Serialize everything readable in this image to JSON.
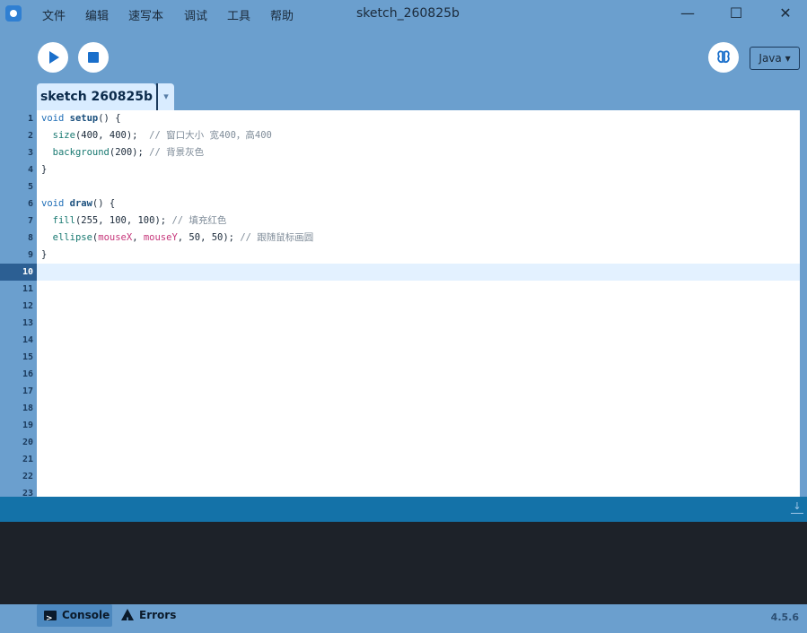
{
  "app": {
    "window_title": "sketch_260825b",
    "version": "4.5.6"
  },
  "menu": {
    "items": [
      "文件",
      "编辑",
      "速写本",
      "调试",
      "工具",
      "帮助"
    ]
  },
  "window_controls": {
    "minimize": "—",
    "maximize": "☐",
    "close": "✕"
  },
  "toolbar": {
    "run_icon": "play-icon",
    "stop_icon": "stop-icon",
    "debugger_icon": "butterfly-icon",
    "mode": "Java ▾"
  },
  "tabs": {
    "active": "sketch 260825b",
    "menu_arrow": "▾"
  },
  "editor": {
    "current_line": 10,
    "line_numbers": [
      "1",
      "2",
      "3",
      "4",
      "5",
      "6",
      "7",
      "8",
      "9",
      "10",
      "11",
      "12",
      "13",
      "14",
      "15",
      "16",
      "17",
      "18",
      "19",
      "20",
      "21",
      "22",
      "23"
    ],
    "code": {
      "l1": {
        "kw": "void",
        "fn": "setup",
        "rest": "() {"
      },
      "l2": {
        "call": "size",
        "args": "(400, 400);",
        "comment": "// 窗口大小 宽400，高400"
      },
      "l3": {
        "call": "background",
        "args": "(200);",
        "comment": "// 背景灰色"
      },
      "l4": {
        "text": "}"
      },
      "l6": {
        "kw": "void",
        "fn": "draw",
        "rest": "() {"
      },
      "l7": {
        "call": "fill",
        "args": "(255, 100, 100);",
        "comment": "// 填充红色"
      },
      "l8": {
        "call": "ellipse",
        "open": "(",
        "var1": "mouseX",
        "sep": ", ",
        "var2": "mouseY",
        "args": ", 50, 50);",
        "comment": "// 跟随鼠标画圆"
      },
      "l9": {
        "text": "}"
      }
    }
  },
  "footer": {
    "console_tab": "Console",
    "errors_tab": "Errors"
  },
  "colors": {
    "chrome": "#6b9fce",
    "editor_bg": "#ffffff",
    "console_bg": "#1d2229",
    "divider": "#1472a8",
    "accent": "#1a6fcb"
  }
}
